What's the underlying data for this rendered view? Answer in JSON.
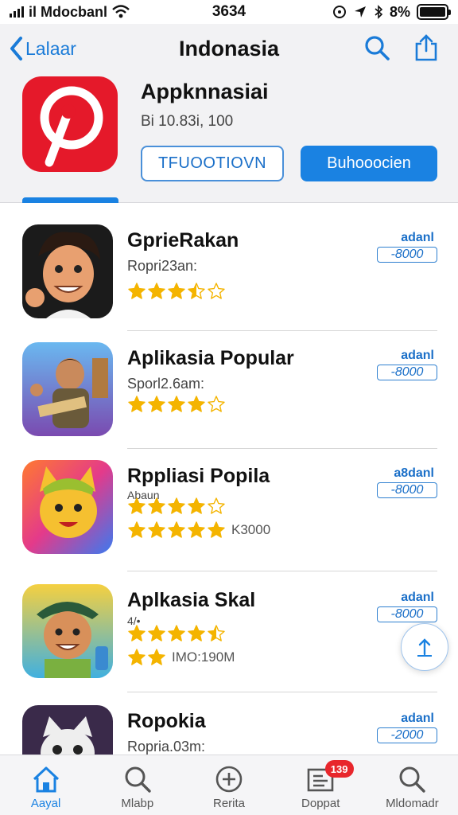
{
  "status_bar": {
    "carrier": "il Mdocbanl",
    "time": "3634",
    "battery_text": "8%"
  },
  "nav": {
    "back_label": "Lalaar",
    "title": "Indonasia"
  },
  "featured": {
    "name": "Appknnasiai",
    "subtitle": "Bi 10.83i, 100",
    "button_outline": "TFUOOTIOVN",
    "button_filled": "Buhooocien",
    "icon_color": "#e5192a"
  },
  "apps": [
    {
      "name": "GprieRakan",
      "subtitle": "Ropri23an:",
      "rating": 3.5,
      "price_label": "adanl",
      "price_value": "-8000"
    },
    {
      "name": "Aplikasia Popular",
      "subtitle": "Sporl2.6am:",
      "rating": 4.0,
      "price_label": "adanl",
      "price_value": "-8000"
    },
    {
      "name": "Rppliasi Popila",
      "subtitle": "Abaun",
      "rating": 4.0,
      "rating2": 5,
      "rating2_text": "K3000",
      "price_label": "a8danl",
      "price_value": "-8000"
    },
    {
      "name": "Aplkasia Skal",
      "subtitle": "4/•",
      "rating": 4.5,
      "rating2": 2,
      "rating2_text": "IMO:190M",
      "price_label": "adanl",
      "price_value": "-8000"
    },
    {
      "name": "Ropokia",
      "subtitle": "Ropria.03m:",
      "price_label": "adanl",
      "price_value": "-2000"
    }
  ],
  "tabs": [
    {
      "label": "Aayal",
      "icon": "home-icon",
      "active": true
    },
    {
      "label": "Mlabp",
      "icon": "search-icon"
    },
    {
      "label": "Rerita",
      "icon": "add-circle-icon"
    },
    {
      "label": "Doppat",
      "icon": "updates-icon",
      "badge": "139"
    },
    {
      "label": "Mldomadr",
      "icon": "search-icon"
    }
  ],
  "colors": {
    "accent": "#1a82e2",
    "star": "#f4b400",
    "badge": "#e8262c"
  }
}
